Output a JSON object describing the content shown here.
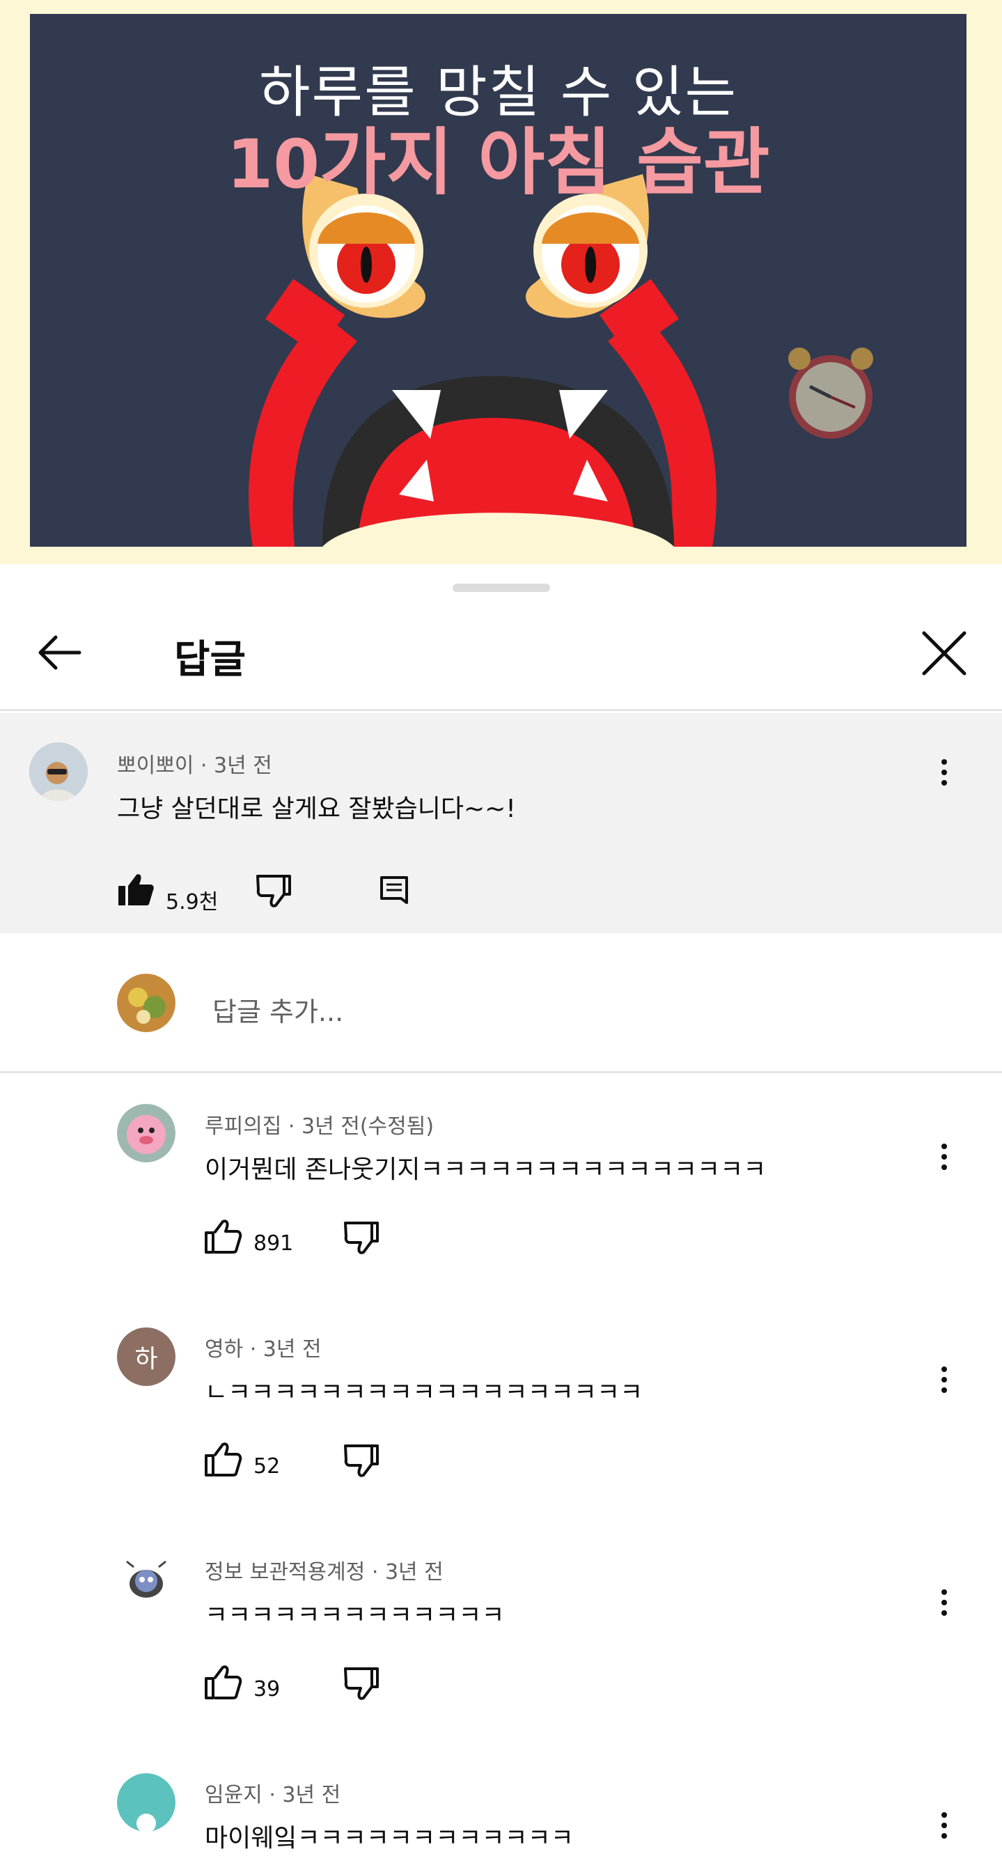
{
  "video": {
    "title_line1": "하루를 망칠 수 있는",
    "title_line2_number": "10",
    "title_line2_text": "가지 아침 습관"
  },
  "sheet": {
    "title": "답글",
    "back_icon": "arrow-left-icon",
    "close_icon": "close-icon"
  },
  "parent_comment": {
    "author": "뽀이뽀이",
    "time": "3년 전",
    "meta": "뽀이뽀이 · 3년 전",
    "text": "그냥 살던대로 살게요 잘봤습니다~~!",
    "likes": "5.9천"
  },
  "reply_input": {
    "placeholder": "답글 추가..."
  },
  "replies": [
    {
      "author": "루피의집",
      "meta": "루피의집 · 3년 전(수정됨)",
      "text": "이거뭔데 존나웃기지ㅋㅋㅋㅋㅋㅋㅋㅋㅋㅋㅋㅋㅋㅋㅋ",
      "likes": "891",
      "avatar_color": "#f4a7c0"
    },
    {
      "author": "영하",
      "meta": "영하 · 3년 전",
      "text": "ㄴㅋㅋㅋㅋㅋㅋㅋㅋㅋㅋㅋㅋㅋㅋㅋㅋㅋㅋ",
      "likes": "52",
      "avatar_letter": "하",
      "avatar_color": "#8d6e63"
    },
    {
      "author": "정보 보관적용계정",
      "meta": "정보 보관적용계정 · 3년 전",
      "text": "ㅋㅋㅋㅋㅋㅋㅋㅋㅋㅋㅋㅋㅋ",
      "likes": "39",
      "avatar_color": "#ffffff"
    },
    {
      "author": "임윤지",
      "meta": "임윤지 · 3년 전",
      "text": "마이웨잌ㅋㅋㅋㅋㅋㅋㅋㅋㅋㅋㅋㅋ",
      "likes": "",
      "avatar_color": "#5bc2bd"
    }
  ],
  "colors": {
    "frame_bg": "#323a4f",
    "title_pink": "#f59aa0",
    "monster_red": "#ee1d25",
    "parent_bg": "#f2f2f2",
    "meta_gray": "#606060"
  }
}
